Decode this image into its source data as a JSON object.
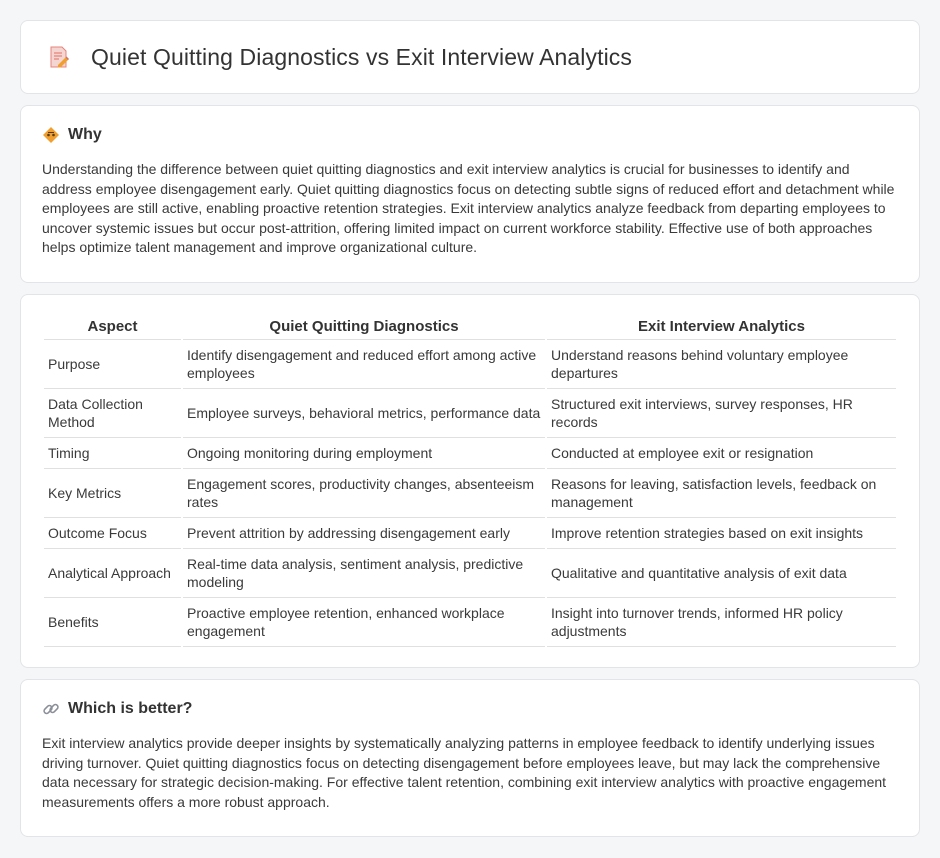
{
  "header": {
    "title": "Quiet Quitting Diagnostics vs Exit Interview Analytics",
    "icon": "document-pencil-icon"
  },
  "why": {
    "icon": "diamond-warning-icon",
    "title": "Why",
    "text": "Understanding the difference between quiet quitting diagnostics and exit interview analytics is crucial for businesses to identify and address employee disengagement early. Quiet quitting diagnostics focus on detecting subtle signs of reduced effort and detachment while employees are still active, enabling proactive retention strategies. Exit interview analytics analyze feedback from departing employees to uncover systemic issues but occur post-attrition, offering limited impact on current workforce stability. Effective use of both approaches helps optimize talent management and improve organizational culture."
  },
  "table": {
    "headers": [
      "Aspect",
      "Quiet Quitting Diagnostics",
      "Exit Interview Analytics"
    ],
    "rows": [
      [
        "Purpose",
        "Identify disengagement and reduced effort among active employees",
        "Understand reasons behind voluntary employee departures"
      ],
      [
        "Data Collection Method",
        "Employee surveys, behavioral metrics, performance data",
        "Structured exit interviews, survey responses, HR records"
      ],
      [
        "Timing",
        "Ongoing monitoring during employment",
        "Conducted at employee exit or resignation"
      ],
      [
        "Key Metrics",
        "Engagement scores, productivity changes, absenteeism rates",
        "Reasons for leaving, satisfaction levels, feedback on management"
      ],
      [
        "Outcome Focus",
        "Prevent attrition by addressing disengagement early",
        "Improve retention strategies based on exit insights"
      ],
      [
        "Analytical Approach",
        "Real-time data analysis, sentiment analysis, predictive modeling",
        "Qualitative and quantitative analysis of exit data"
      ],
      [
        "Benefits",
        "Proactive employee retention, enhanced workplace engagement",
        "Insight into turnover trends, informed HR policy adjustments"
      ]
    ]
  },
  "better": {
    "icon": "link-icon",
    "title": "Which is better?",
    "text": "Exit interview analytics provide deeper insights by systematically analyzing patterns in employee feedback to identify underlying issues driving turnover. Quiet quitting diagnostics focus on detecting disengagement before employees leave, but may lack the comprehensive data necessary for strategic decision-making. For effective talent retention, combining exit interview analytics with proactive engagement measurements offers a more robust approach."
  },
  "colors": {
    "background": "#f5f6f8",
    "card": "#ffffff",
    "border": "#e2e4e8",
    "accent_orange": "#f0a030",
    "icon_pink": "#e8837a"
  }
}
